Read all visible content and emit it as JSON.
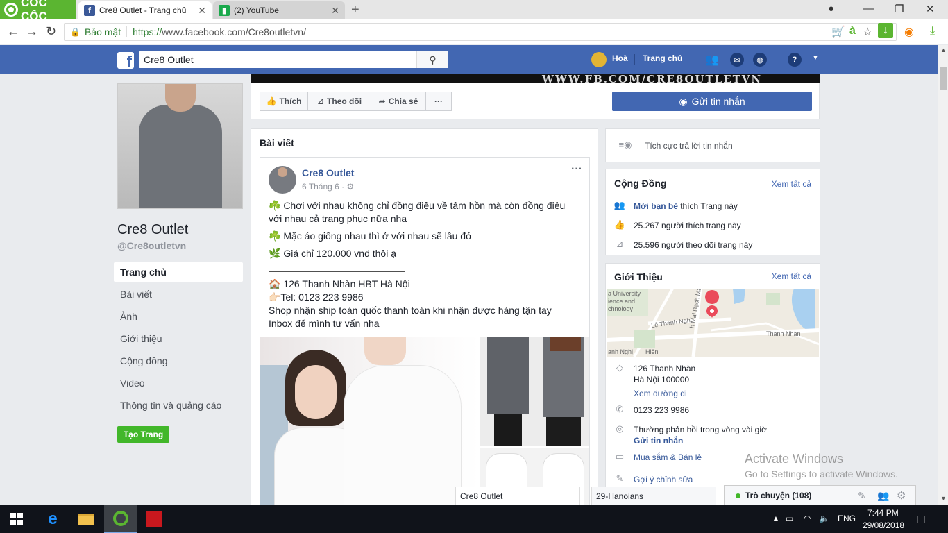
{
  "browser": {
    "brand": "CỐC CỐC",
    "tabs": [
      {
        "title": "Cre8 Outlet - Trang chủ",
        "icon": "facebook-icon",
        "active": true
      },
      {
        "title": "(2) YouTube",
        "icon": "youtube-icon",
        "active": false
      }
    ],
    "secure_label": "Bảo mật",
    "url_protocol": "https://",
    "url_rest": "www.facebook.com/Cre8outletvn/"
  },
  "fb_header": {
    "search_value": "Cre8 Outlet",
    "user_name": "Hoà",
    "home_label": "Trang chủ"
  },
  "left_nav": {
    "page_name": "Cre8 Outlet",
    "page_handle": "@Cre8outletvn",
    "items": [
      "Trang chủ",
      "Bài viết",
      "Ảnh",
      "Giới thiệu",
      "Cộng đồng",
      "Video",
      "Thông tin và quảng cáo"
    ],
    "create_page": "Tạo Trang"
  },
  "cover_text": "WWW.FB.COM/CRE8OUTLETVN",
  "actions": {
    "like": "Thích",
    "follow": "Theo dõi",
    "share": "Chia sẻ",
    "more": "···",
    "send_message": "Gửi tin nhắn"
  },
  "posts": {
    "section_title": "Bài viết",
    "author": "Cre8 Outlet",
    "date": "6 Tháng 6 ·",
    "lines": [
      "☘️ Chơi với nhau không chỉ đồng điệu về tâm hồn mà còn đồng điệu với nhau cả trang phục nữa nha",
      "☘️ Mặc áo giống nhau thì ở với nhau sẽ lâu đó",
      "🌿 Giá chỉ 120.000 vnd thôi ạ",
      "——————————————",
      "🏠 126 Thanh Nhàn HBT Hà Nội",
      "👉🏻Tel: 0123 223 9986",
      "Shop nhận ship toàn quốc thanh toán khi nhận được hàng tận tay",
      "Inbox để mình tư vấn nha"
    ]
  },
  "right": {
    "responsive": "Tích cực trả lời tin nhắn",
    "community": {
      "title": "Cộng Đồng",
      "see_all": "Xem tất cả",
      "invite_link": "Mời bạn bè",
      "invite_rest": " thích Trang này",
      "likes": "25.267 người thích trang này",
      "followers": "25.596 người theo dõi trang này"
    },
    "about": {
      "title": "Giới Thiệu",
      "see_all": "Xem tất cả",
      "map_labels": [
        "a University",
        "ience and",
        "chnology",
        "Lê Thanh Nghị",
        "Thanh Nhàn",
        "h Mai Bạch Mai",
        "anh Nghị",
        "Hiền"
      ],
      "address1": "126 Thanh Nhàn",
      "address2": "Hà Nội 100000",
      "directions": "Xem đường đi",
      "phone": "0123 223 9986",
      "response": "Thường phản hồi trong vòng vài giờ",
      "send_msg": "Gửi tin nhắn",
      "category": "Mua sắm & Bán lẻ",
      "suggest": "Gợi ý chỉnh sửa"
    }
  },
  "chat": {
    "boxes": [
      "Cre8 Outlet",
      "29-Hanoians"
    ],
    "main": "Trò chuyện (108)"
  },
  "watermark": {
    "line1": "Activate Windows",
    "line2": "Go to Settings to activate Windows."
  },
  "taskbar": {
    "lang": "ENG",
    "time": "7:44 PM",
    "date": "29/08/2018"
  },
  "colors": {
    "fb_blue": "#4267b2",
    "coccoc_green": "#5bb531",
    "link": "#365899",
    "create_green": "#42b72a"
  }
}
